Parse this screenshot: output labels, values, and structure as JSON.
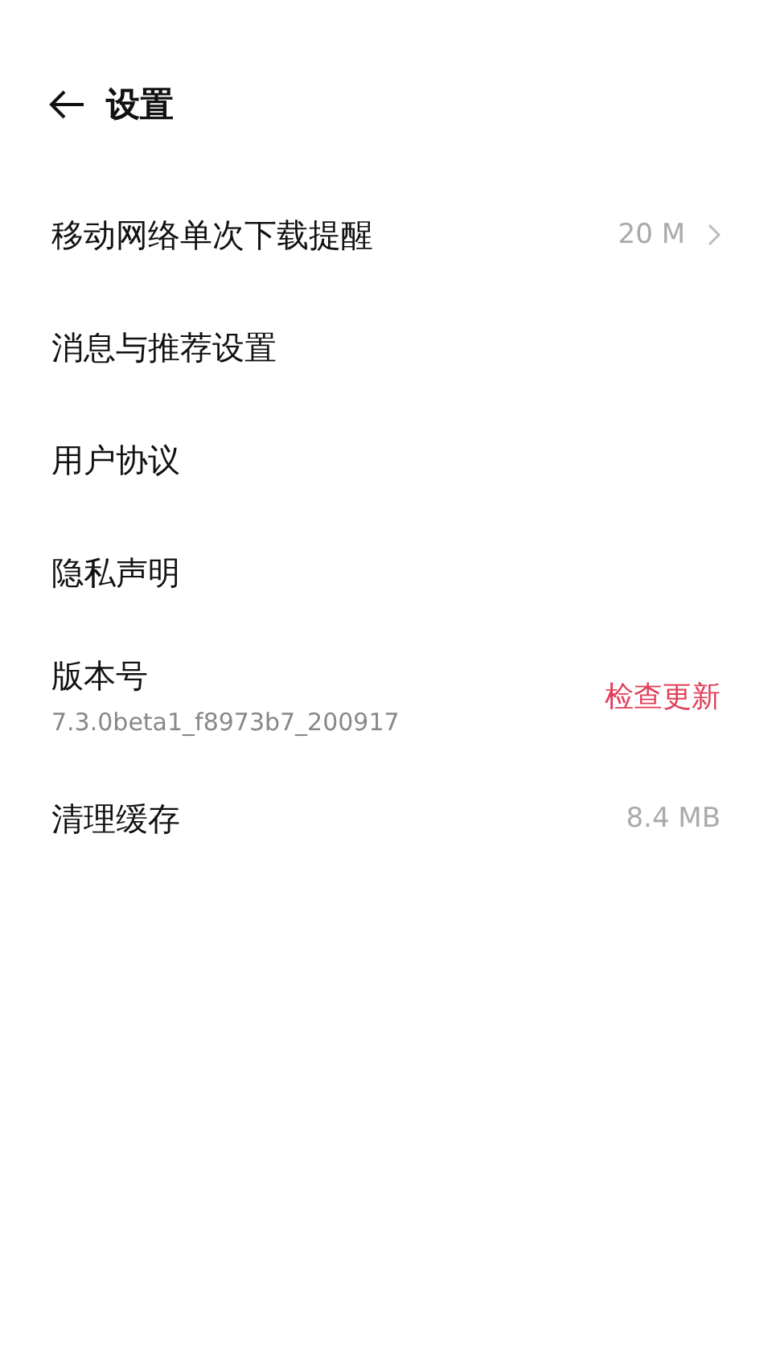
{
  "header": {
    "title": "设置"
  },
  "items": [
    {
      "kind": "link",
      "title": "移动网络单次下载提醒",
      "value": "20 M"
    },
    {
      "kind": "plain",
      "title": "消息与推荐设置"
    },
    {
      "kind": "plain",
      "title": "用户协议"
    },
    {
      "kind": "plain",
      "title": "隐私声明"
    },
    {
      "kind": "version",
      "title": "版本号",
      "subtitle": "7.3.0beta1_f8973b7_200917",
      "action": "检查更新"
    },
    {
      "kind": "info",
      "title": "清理缓存",
      "value": "8.4 MB"
    }
  ]
}
